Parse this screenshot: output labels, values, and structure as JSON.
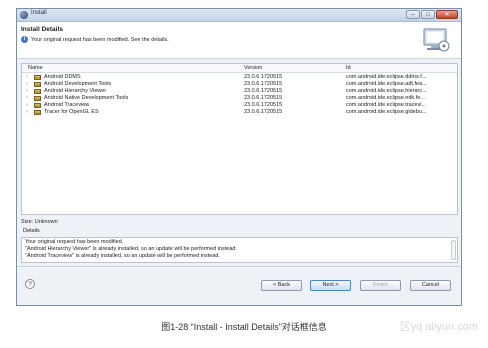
{
  "window": {
    "title": "Install"
  },
  "header": {
    "title": "Install Details",
    "message": "Your original request has been modified.  See the details."
  },
  "table": {
    "columns": [
      "Name",
      "Version",
      "Id"
    ],
    "rows": [
      {
        "name": "Android DDMS",
        "version": "23.0.6.1720515",
        "id": "com.android.ide.eclipse.ddms.f..."
      },
      {
        "name": "Android Development Tools",
        "version": "23.0.6.1720515",
        "id": "com.android.ide.eclipse.adt.fea..."
      },
      {
        "name": "Android Hierarchy Viewer",
        "version": "23.0.6.1720515",
        "id": "com.android.ide.eclipse.hierarc..."
      },
      {
        "name": "Android Native Development Tools",
        "version": "23.0.6.1720515",
        "id": "com.android.ide.eclipse.ndk.fe..."
      },
      {
        "name": "Android Traceview",
        "version": "23.0.6.1720515",
        "id": "com.android.ide.eclipse.tracevi..."
      },
      {
        "name": "Tracer for OpenGL ES",
        "version": "23.0.6.1720515",
        "id": "com.android.ide.eclipse.gldebu..."
      }
    ]
  },
  "size": "Size: Unknown",
  "details": {
    "label": "Details",
    "lines": [
      "Your original request has been modified.",
      "\"Android Hierarchy Viewer\" is already installed, so an update will be performed instead.",
      "\"Android Traceview\" is already installed, so an update will be performed instead."
    ]
  },
  "buttons": {
    "help": "?",
    "back": "< Back",
    "next": "Next >",
    "finish": "Finish",
    "cancel": "Cancel"
  },
  "caption": "图1-28 “Install - Install    Details”对话框信息",
  "watermark": "区yq.aliyun.com"
}
